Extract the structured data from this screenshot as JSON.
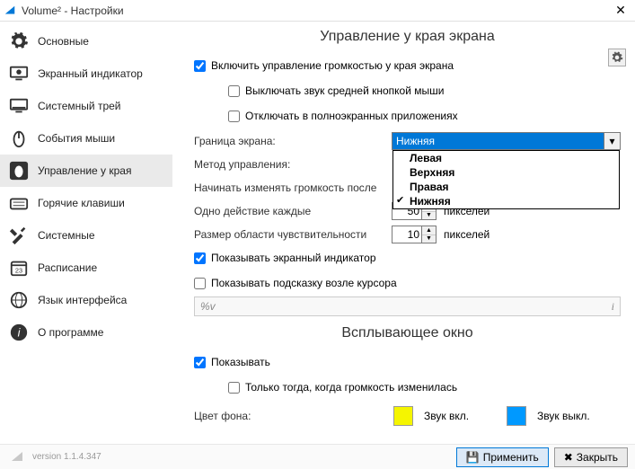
{
  "window": {
    "title": "Volume² - Настройки"
  },
  "sidebar": {
    "items": [
      {
        "label": "Основные"
      },
      {
        "label": "Экранный индикатор"
      },
      {
        "label": "Системный трей"
      },
      {
        "label": "События мыши"
      },
      {
        "label": "Управление у края"
      },
      {
        "label": "Горячие клавиши"
      },
      {
        "label": "Системные"
      },
      {
        "label": "Расписание"
      },
      {
        "label": "Язык интерфейса"
      },
      {
        "label": "О программе"
      }
    ]
  },
  "section1": {
    "title": "Управление у края экрана",
    "enable": "Включить управление громкостью у края экрана",
    "mute_middle": "Выключать звук средней кнопкой мыши",
    "disable_fullscreen": "Отключать в полноэкранных приложениях",
    "border_lbl": "Граница экрана:",
    "border_val": "Нижняя",
    "border_opts": [
      "Левая",
      "Верхняя",
      "Правая",
      "Нижняя"
    ],
    "method_lbl": "Метод управления:",
    "delay_lbl": "Начинать изменять громкость после",
    "step_lbl": "Одно действие каждые",
    "step_val": "50",
    "step_unit": "пикселей",
    "area_lbl": "Размер области чувствительности",
    "area_val": "10",
    "area_unit": "пикселей",
    "show_osd": "Показывать экранный индикатор",
    "show_hint": "Показывать подсказку возле курсора",
    "pct": "%v",
    "info": "i"
  },
  "section2": {
    "title": "Всплывающее окно",
    "show": "Показывать",
    "only_changed": "Только тогда, когда громкость изменилась",
    "bgcolor_lbl": "Цвет фона:",
    "sound_on": "Звук вкл.",
    "sound_off": "Звук выкл.",
    "color_on": "#f5f500",
    "color_off": "#0099ff"
  },
  "footer": {
    "version": "version 1.1.4.347",
    "apply": "Применить",
    "close": "Закрыть"
  }
}
